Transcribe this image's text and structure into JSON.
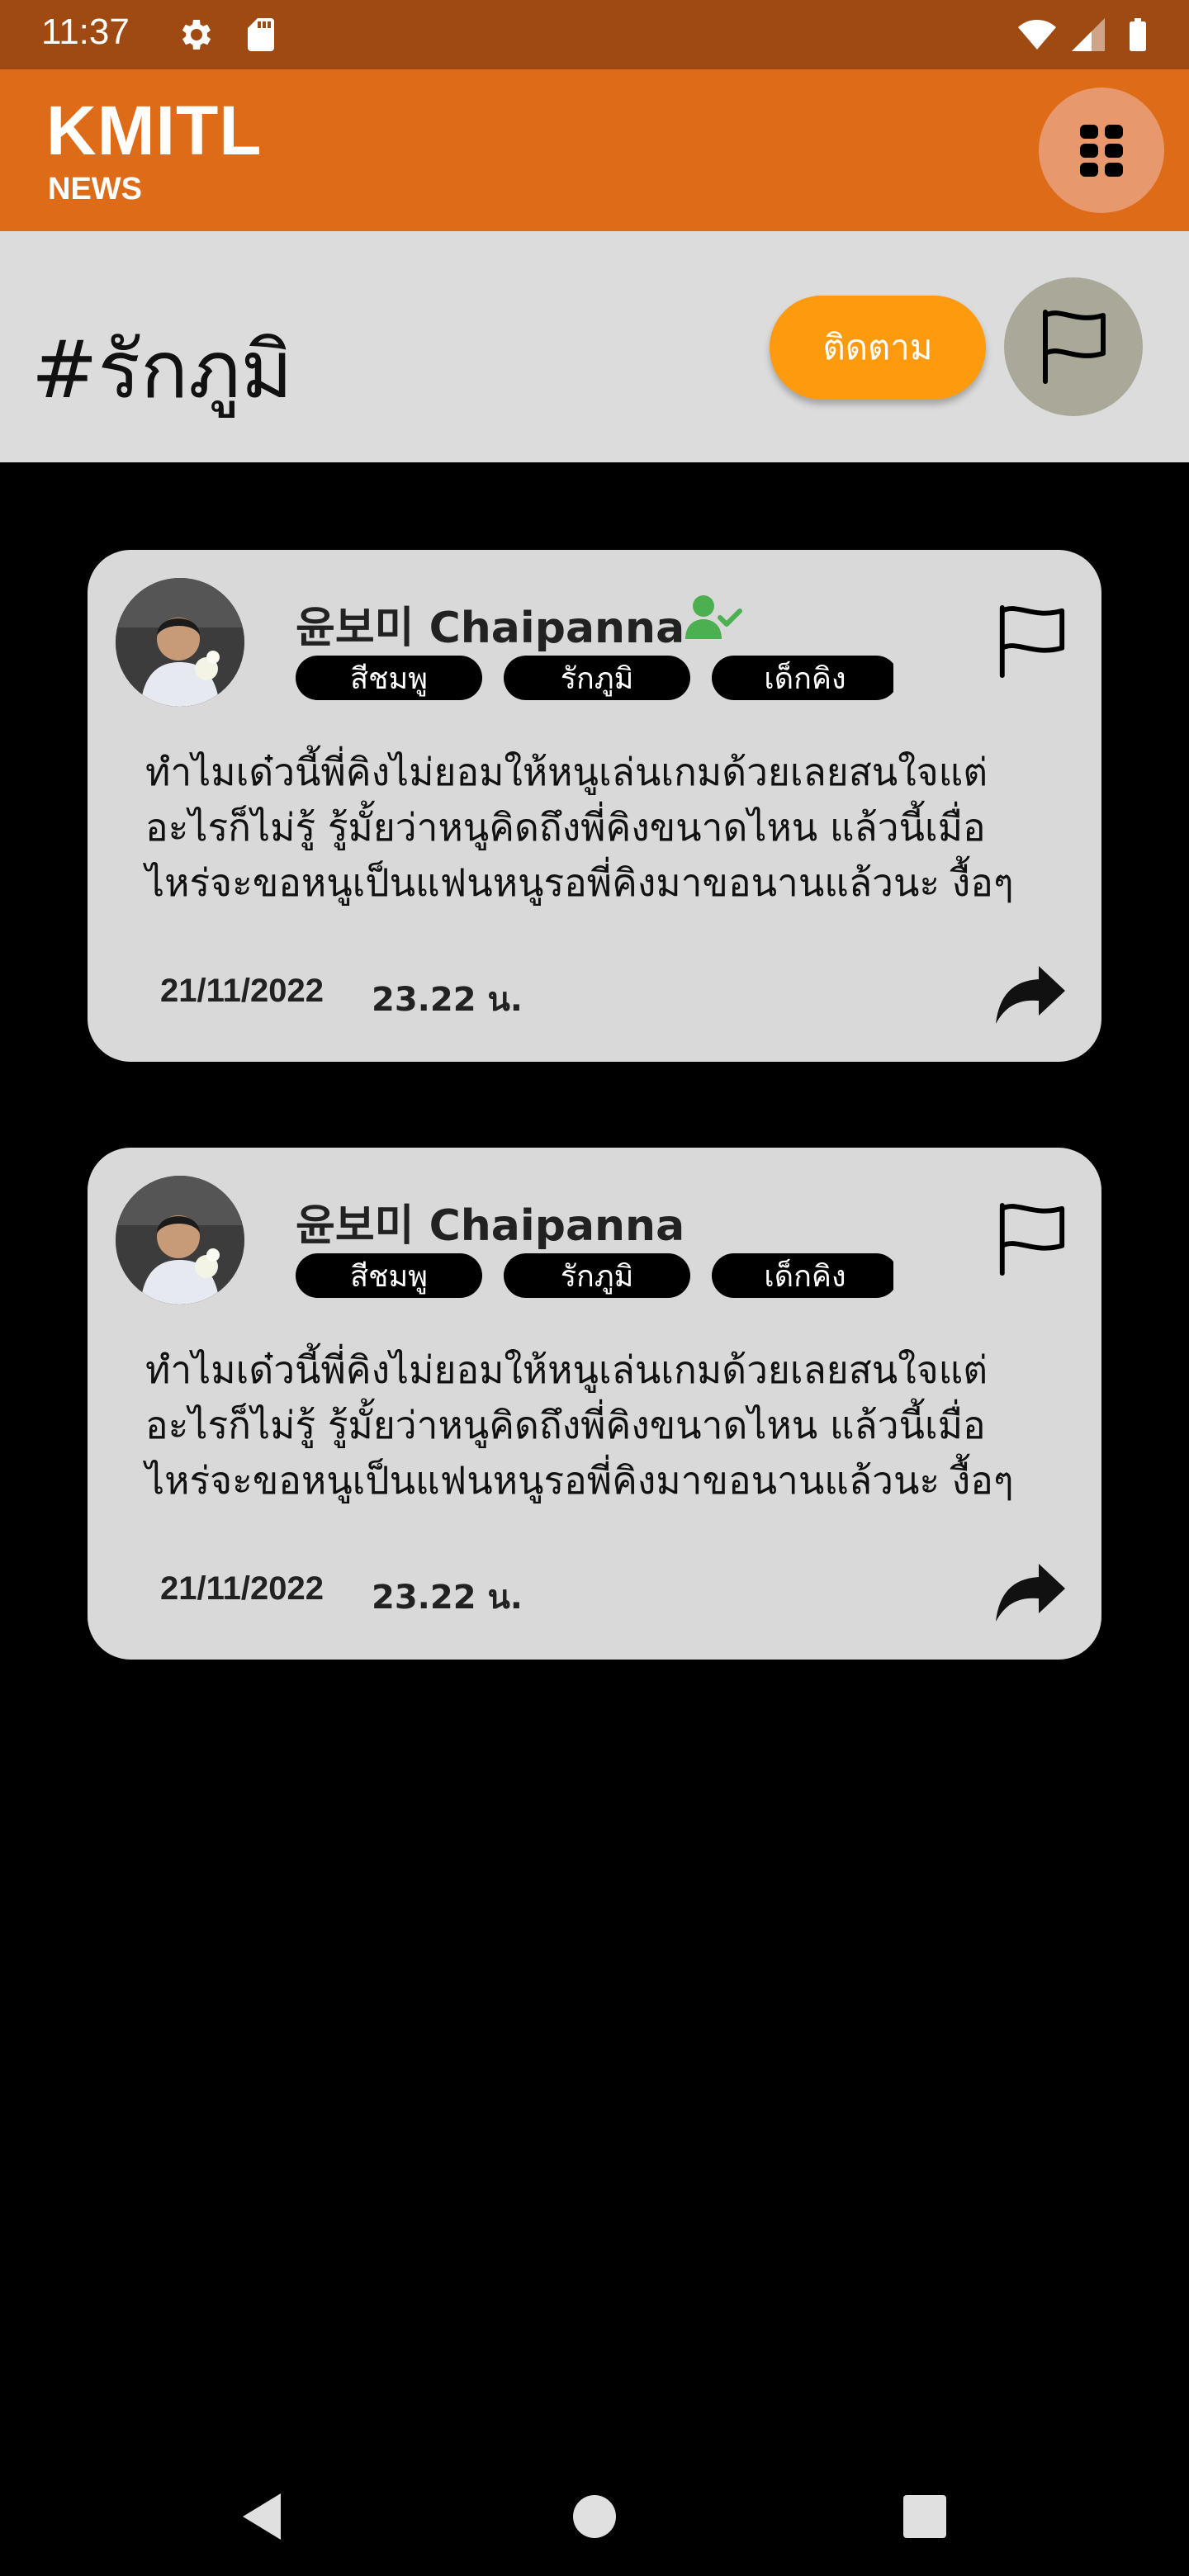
{
  "status_bar": {
    "time": "11:37",
    "icons": [
      "settings-icon",
      "sd-card-icon",
      "wifi-icon",
      "signal-icon",
      "battery-icon"
    ]
  },
  "app_bar": {
    "title": "KMITL",
    "subtitle": "NEWS",
    "menu_icon": "grid-menu-icon",
    "color": "#de6b18"
  },
  "hashtag": {
    "title": "#รักภูมิ",
    "follow_label": "ติดตาม",
    "follow_color": "#fd9a0d",
    "report_icon": "flag-icon"
  },
  "posts": [
    {
      "author": "윤보미 Chaipanna",
      "verified": true,
      "tags": [
        "สีชมพู",
        "รักภูมิ",
        "เด็กคิง"
      ],
      "body_lines": [
        "ทำไมเด๋วนี้พี่คิงไม่ยอมให้หนูเล่นเกมด้วยเลยสนใจแต่",
        "อะไรก็ไม่รู้ รู้มั้ยว่าหนูคิดถึงพี่คิงขนาดไหน แล้วนี้เมื่อ",
        "ไหร่จะขอหนูเป็นแฟนหนูรอพี่คิงมาขอนานแล้วนะ งื้อๆ"
      ],
      "date": "21/11/2022",
      "time": "23.22 น."
    },
    {
      "author": "윤보미 Chaipanna",
      "verified": false,
      "tags": [
        "สีชมพู",
        "รักภูมิ",
        "เด็กคิง"
      ],
      "body_lines": [
        "ทำไมเด๋วนี้พี่คิงไม่ยอมให้หนูเล่นเกมด้วยเลยสนใจแต่",
        "อะไรก็ไม่รู้ รู้มั้ยว่าหนูคิดถึงพี่คิงขนาดไหน แล้วนี้เมื่อ",
        "ไหร่จะขอหนูเป็นแฟนหนูรอพี่คิงมาขอนานแล้วนะ งื้อๆ"
      ],
      "date": "21/11/2022",
      "time": "23.22 น."
    }
  ],
  "nav_bar": {
    "icons": [
      "back-icon",
      "home-icon",
      "recents-icon"
    ]
  }
}
